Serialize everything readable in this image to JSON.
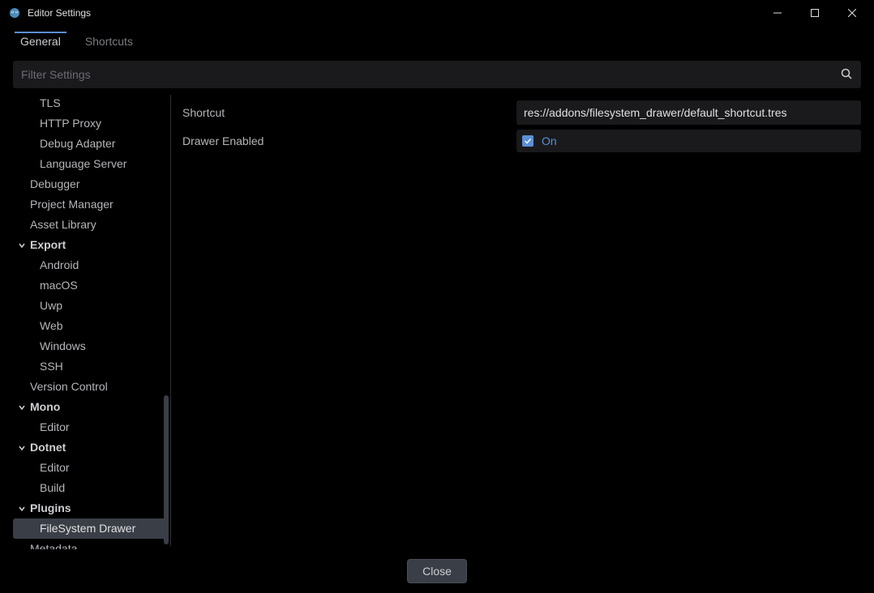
{
  "window": {
    "title": "Editor Settings"
  },
  "tabs": {
    "general": "General",
    "shortcuts": "Shortcuts"
  },
  "search": {
    "placeholder": "Filter Settings"
  },
  "sidebar": {
    "items": [
      {
        "label": "TLS",
        "level": 2
      },
      {
        "label": "HTTP Proxy",
        "level": 2
      },
      {
        "label": "Debug Adapter",
        "level": 2
      },
      {
        "label": "Language Server",
        "level": 2
      },
      {
        "label": "Debugger",
        "level": 1
      },
      {
        "label": "Project Manager",
        "level": 1
      },
      {
        "label": "Asset Library",
        "level": 1
      },
      {
        "label": "Export",
        "level": 1,
        "collapsible": true
      },
      {
        "label": "Android",
        "level": 2
      },
      {
        "label": "macOS",
        "level": 2
      },
      {
        "label": "Uwp",
        "level": 2
      },
      {
        "label": "Web",
        "level": 2
      },
      {
        "label": "Windows",
        "level": 2
      },
      {
        "label": "SSH",
        "level": 2
      },
      {
        "label": "Version Control",
        "level": 1
      },
      {
        "label": "Mono",
        "level": 1,
        "collapsible": true
      },
      {
        "label": "Editor",
        "level": 2
      },
      {
        "label": "Dotnet",
        "level": 1,
        "collapsible": true
      },
      {
        "label": "Editor",
        "level": 2
      },
      {
        "label": "Build",
        "level": 2
      },
      {
        "label": "Plugins",
        "level": 1,
        "collapsible": true
      },
      {
        "label": "FileSystem Drawer",
        "level": 2,
        "selected": true
      },
      {
        "label": "Metadata",
        "level": 1
      }
    ]
  },
  "settings": {
    "shortcut": {
      "label": "Shortcut",
      "value": "res://addons/filesystem_drawer/default_shortcut.tres"
    },
    "drawer_enabled": {
      "label": "Drawer Enabled",
      "checkbox_label": "On",
      "checked": true
    }
  },
  "footer": {
    "close": "Close"
  }
}
